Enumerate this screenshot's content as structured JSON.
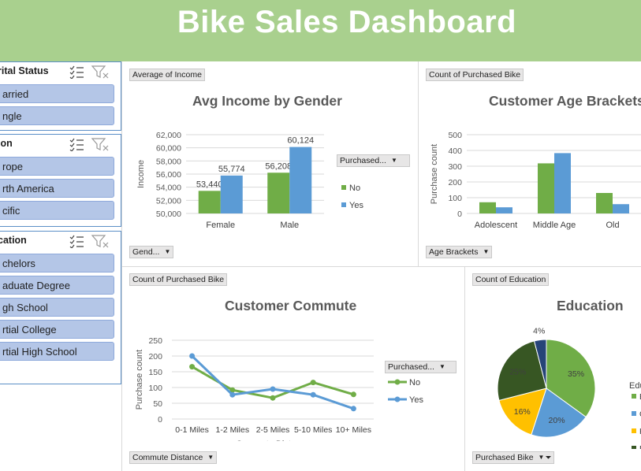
{
  "dashboard": {
    "title": "Bike Sales Dashboard"
  },
  "slicers": [
    {
      "title": "rital Status",
      "items": [
        "arried",
        "ngle"
      ]
    },
    {
      "title": "ion",
      "items": [
        "rope",
        "rth America",
        "cific"
      ]
    },
    {
      "title": "cation",
      "items": [
        "chelors",
        "aduate Degree",
        "gh School",
        "rtial College",
        "rtial High School"
      ]
    }
  ],
  "icons": {
    "multiselect": "multi-select-icon",
    "clear_filter": "clear-filter-icon",
    "dropdown": "chevron-down-icon",
    "filter": "filter-icon"
  },
  "colors": {
    "banner": "#a9d08e",
    "no_series": "#70ad47",
    "yes_series": "#5b9bd5",
    "slicer_item": "#b4c6e7"
  },
  "income_chart": {
    "field_button": "Average of Income",
    "axis_button": "Gend...",
    "legend_button": "Purchased...",
    "chart_data": {
      "type": "bar",
      "title": "Avg Income by Gender",
      "xlabel": "Gender",
      "ylabel": "Income",
      "categories": [
        "Female",
        "Male"
      ],
      "series": [
        {
          "name": "No",
          "values": [
            53440,
            56208
          ],
          "labels": [
            "53,440",
            "56,208"
          ]
        },
        {
          "name": "Yes",
          "values": [
            55774,
            60124
          ],
          "labels": [
            "55,774",
            "60,124"
          ]
        }
      ],
      "ylim": [
        50000,
        62000
      ],
      "yticks": [
        "50,000",
        "52,000",
        "54,000",
        "56,000",
        "58,000",
        "60,000",
        "62,000"
      ],
      "grid": true,
      "legend": "right"
    }
  },
  "age_chart": {
    "field_button": "Count of Purchased Bike",
    "axis_button": "Age Brackets",
    "chart_data": {
      "type": "bar",
      "title": "Customer Age Brackets",
      "xlabel": "Age Bracket",
      "ylabel": "Purchase count",
      "categories": [
        "Adolescent",
        "Middle Age",
        "Old"
      ],
      "series": [
        {
          "name": "No",
          "values": [
            71,
            318,
            130
          ]
        },
        {
          "name": "Yes",
          "values": [
            39,
            383,
            59
          ]
        }
      ],
      "ylim": [
        0,
        500
      ],
      "yticks": [
        "0",
        "100",
        "200",
        "300",
        "400",
        "500"
      ],
      "grid": true
    }
  },
  "commute_chart": {
    "field_button": "Count of Purchased Bike",
    "axis_button": "Commute Distance",
    "legend_button": "Purchased...",
    "chart_data": {
      "type": "line",
      "title": "Customer Commute",
      "xlabel": "Commute Distance",
      "ylabel": "Purchase count",
      "categories": [
        "0-1 Miles",
        "1-2 Miles",
        "2-5 Miles",
        "5-10 Miles",
        "10+ Miles"
      ],
      "series": [
        {
          "name": "No",
          "values": [
            166,
            92,
            67,
            116,
            78
          ]
        },
        {
          "name": "Yes",
          "values": [
            200,
            77,
            95,
            77,
            33
          ]
        }
      ],
      "ylim": [
        0,
        250
      ],
      "yticks": [
        "0",
        "50",
        "100",
        "150",
        "200",
        "250"
      ],
      "grid": true,
      "legend": "right"
    }
  },
  "education_chart": {
    "field_button": "Count of Education",
    "filter_button": "Purchased Bike",
    "legend_title": "Edu",
    "legend_items": [
      "B",
      "G",
      "H",
      "P",
      "P"
    ],
    "chart_data": {
      "type": "pie",
      "title": "Education",
      "slices": [
        {
          "value": 35,
          "label": "35%",
          "color": "#70ad47"
        },
        {
          "value": 20,
          "label": "20%",
          "color": "#5b9bd5"
        },
        {
          "value": 16,
          "label": "16%",
          "color": "#ffc000"
        },
        {
          "value": 25,
          "label": "25%",
          "color": "#375623"
        },
        {
          "value": 4,
          "label": "4%",
          "color": "#264478"
        }
      ]
    }
  }
}
